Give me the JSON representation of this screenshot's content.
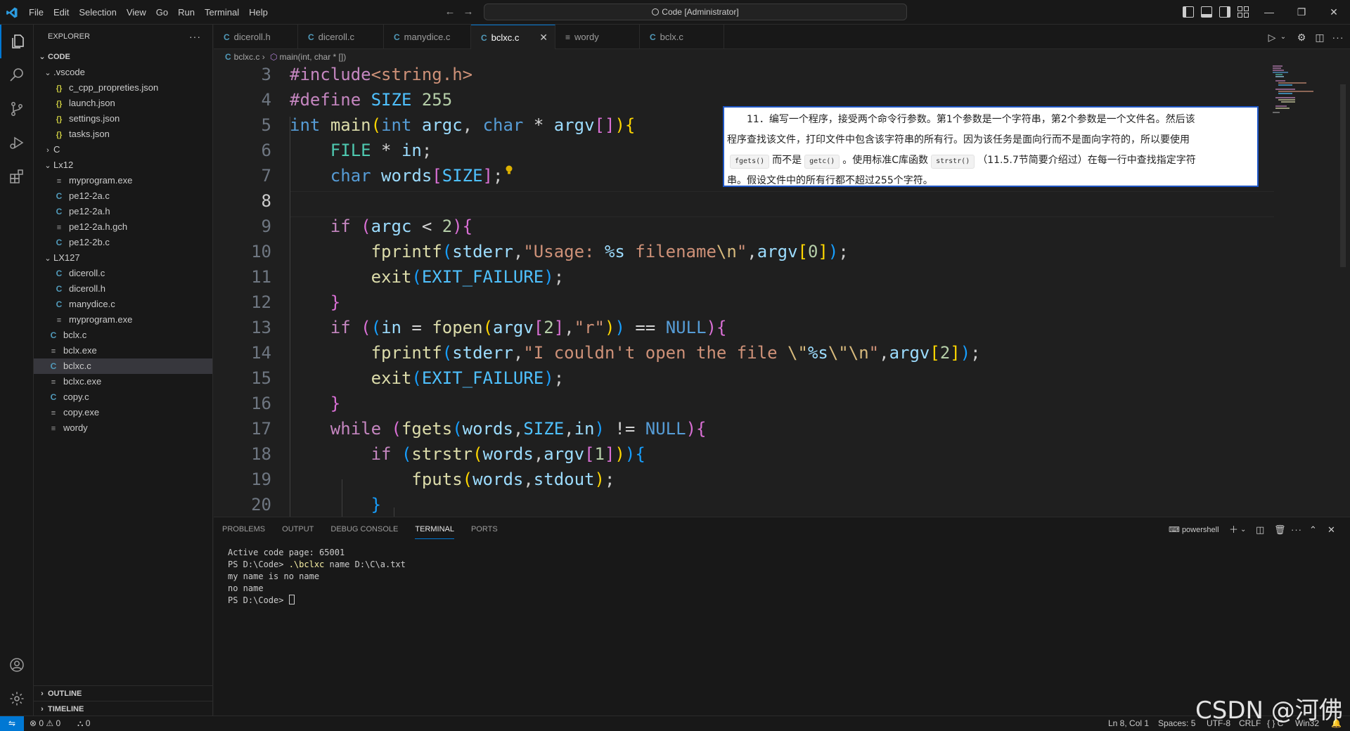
{
  "titlebar": {
    "menus": [
      "File",
      "Edit",
      "Selection",
      "View",
      "Go",
      "Run",
      "Terminal",
      "Help"
    ],
    "command_center": "Code [Administrator]",
    "back_arrow": "←",
    "forward_arrow": "→",
    "minimize": "—",
    "restore": "❐",
    "close": "✕"
  },
  "sidebar": {
    "title": "EXPLORER",
    "more": "···",
    "root": "CODE",
    "tree": [
      {
        "label": ".vscode",
        "type": "folder",
        "open": true,
        "depth": 1
      },
      {
        "label": "c_cpp_propreties.json",
        "type": "json",
        "depth": 2
      },
      {
        "label": "launch.json",
        "type": "json",
        "depth": 2
      },
      {
        "label": "settings.json",
        "type": "json",
        "depth": 2
      },
      {
        "label": "tasks.json",
        "type": "json",
        "depth": 2
      },
      {
        "label": "C",
        "type": "folder",
        "open": false,
        "depth": 1
      },
      {
        "label": "Lx12",
        "type": "folder",
        "open": true,
        "depth": 1
      },
      {
        "label": "myprogram.exe",
        "type": "gen",
        "depth": 2
      },
      {
        "label": "pe12-2a.c",
        "type": "c",
        "depth": 2
      },
      {
        "label": "pe12-2a.h",
        "type": "c",
        "depth": 2
      },
      {
        "label": "pe12-2a.h.gch",
        "type": "gen",
        "depth": 2
      },
      {
        "label": "pe12-2b.c",
        "type": "c",
        "depth": 2
      },
      {
        "label": "LX127",
        "type": "folder",
        "open": true,
        "depth": 1
      },
      {
        "label": "diceroll.c",
        "type": "c",
        "depth": 2
      },
      {
        "label": "diceroll.h",
        "type": "c",
        "depth": 2
      },
      {
        "label": "manydice.c",
        "type": "c",
        "depth": 2
      },
      {
        "label": "myprogram.exe",
        "type": "gen",
        "depth": 2
      },
      {
        "label": "bclx.c",
        "type": "c",
        "depth": 1
      },
      {
        "label": "bclx.exe",
        "type": "gen",
        "depth": 1
      },
      {
        "label": "bclxc.c",
        "type": "c",
        "depth": 1,
        "selected": true
      },
      {
        "label": "bclxc.exe",
        "type": "gen",
        "depth": 1
      },
      {
        "label": "copy.c",
        "type": "c",
        "depth": 1
      },
      {
        "label": "copy.exe",
        "type": "gen",
        "depth": 1
      },
      {
        "label": "wordy",
        "type": "gen",
        "depth": 1
      }
    ],
    "outline": "OUTLINE",
    "timeline": "TIMELINE"
  },
  "tabs": [
    {
      "label": "diceroll.h",
      "type": "c"
    },
    {
      "label": "diceroll.c",
      "type": "c"
    },
    {
      "label": "manydice.c",
      "type": "c"
    },
    {
      "label": "bclxc.c",
      "type": "c",
      "active": true
    },
    {
      "label": "wordy",
      "type": "gen"
    },
    {
      "label": "bclx.c",
      "type": "c"
    }
  ],
  "breadcrumb": {
    "file": "bclxc.c",
    "symbol": "main(int, char * [])"
  },
  "editor": {
    "current_line": 8,
    "line_numbers": [
      "3",
      "4",
      "5",
      "6",
      "7",
      "8",
      "9",
      "10",
      "11",
      "12",
      "13",
      "14",
      "15",
      "16",
      "17",
      "18",
      "19",
      "20"
    ]
  },
  "note": {
    "line1": "11．编写一个程序，接受两个命令行参数。第1个参数是一个字符串，第2个参数是一个文件名。然后该",
    "line2": "程序查找该文件，打印文件中包含该字符串的所有行。因为该任务是面向行而不是面向字符的，所以要使用",
    "chip1": "fgets()",
    "mid1": "而不是",
    "chip2": "getc()",
    "mid2": "。使用标准C库函数",
    "chip3": "strstr()",
    "mid3": "（11.5.7节简要介绍过）在每一行中查找指定字符",
    "line4": "串。假设文件中的所有行都不超过255个字符。"
  },
  "panel": {
    "tabs": [
      "PROBLEMS",
      "OUTPUT",
      "DEBUG CONSOLE",
      "TERMINAL",
      "PORTS"
    ],
    "active_tab": "TERMINAL",
    "shell": "powershell",
    "terminal_lines": {
      "l1": "Active code page: 65001",
      "l2_prompt": "PS D:\\Code> ",
      "l2_cmd": ".\\bclxc",
      "l2_args": " name D:\\C\\a.txt",
      "l3": "my name is no name",
      "l4": "no name",
      "l5_prompt": "PS D:\\Code> "
    }
  },
  "statusbar": {
    "remote": "⇋",
    "problems": "⊗ 0 ⚠ 0",
    "ports": "⛬ 0",
    "position": "Ln 8, Col 1",
    "spaces": "Spaces: 5",
    "encoding": "UTF-8",
    "eol": "CRLF",
    "language": "{ } C",
    "platform": "Win32"
  },
  "watermark": "CSDN @河佛",
  "colors": {
    "accent": "#0078d4",
    "editor_bg": "#1f1f1f",
    "chrome_bg": "#181818"
  }
}
